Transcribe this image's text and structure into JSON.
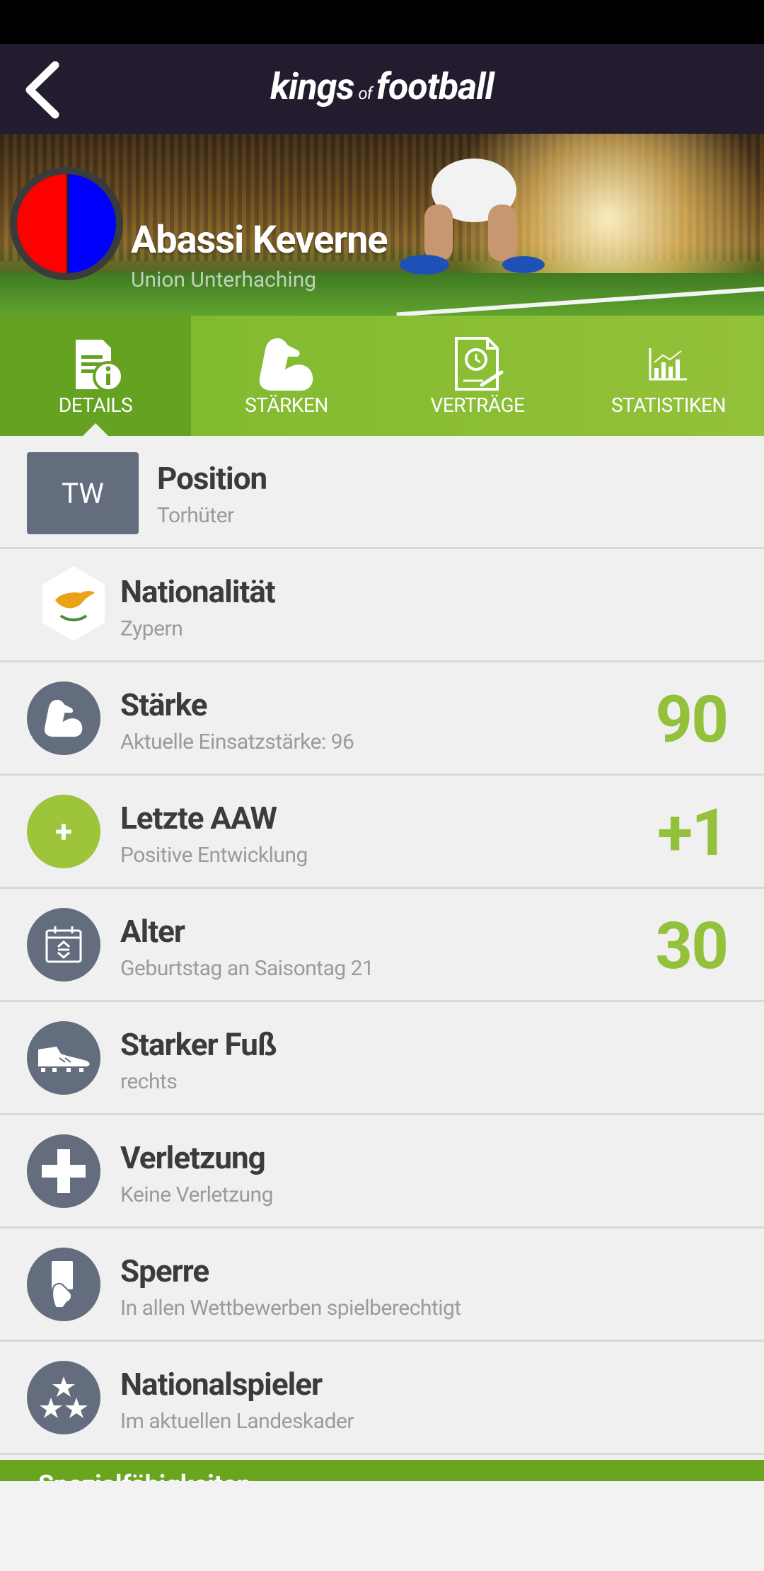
{
  "app": {
    "logo_left": "kings",
    "logo_of": "of",
    "logo_right": "football"
  },
  "hero": {
    "player_name": "Abassi Keverne",
    "club": "Union Unterhaching"
  },
  "tabs": [
    {
      "label": "DETAILS",
      "active": true,
      "icon": "document-info-icon"
    },
    {
      "label": "STÄRKEN",
      "active": false,
      "icon": "flexed-arm-icon"
    },
    {
      "label": "VERTRÄGE",
      "active": false,
      "icon": "contract-clock-icon"
    },
    {
      "label": "STATISTIKEN",
      "active": false,
      "icon": "bar-chart-icon"
    }
  ],
  "rows": [
    {
      "title": "Position",
      "sub": "Torhüter",
      "badge": "TW"
    },
    {
      "title": "Nationalität",
      "sub": "Zypern",
      "icon": "cyprus-flag-icon"
    },
    {
      "title": "Stärke",
      "sub": "Aktuelle Einsatzstärke: 96",
      "value": "90",
      "icon": "flexed-arm-icon"
    },
    {
      "title": "Letzte AAW",
      "sub": "Positive Entwicklung",
      "value": "+1",
      "badge": "+"
    },
    {
      "title": "Alter",
      "sub": "Geburtstag an Saisontag 21",
      "value": "30",
      "icon": "calendar-icon"
    },
    {
      "title": "Starker Fuß",
      "sub": "rechts",
      "icon": "football-boot-icon"
    },
    {
      "title": "Verletzung",
      "sub": "Keine Verletzung",
      "icon": "medical-cross-icon"
    },
    {
      "title": "Sperre",
      "sub": "In allen Wettbewerben spielberechtigt",
      "icon": "referee-card-icon"
    },
    {
      "title": "Nationalspieler",
      "sub": "Im aktuellen Landeskader",
      "icon": "stars-icon"
    }
  ],
  "bottom_section": {
    "label": "Spezialfähigkeiten"
  },
  "colors": {
    "accent_green": "#94c13c",
    "icon_gray": "#636d7d",
    "topbar": "#231c2e"
  }
}
